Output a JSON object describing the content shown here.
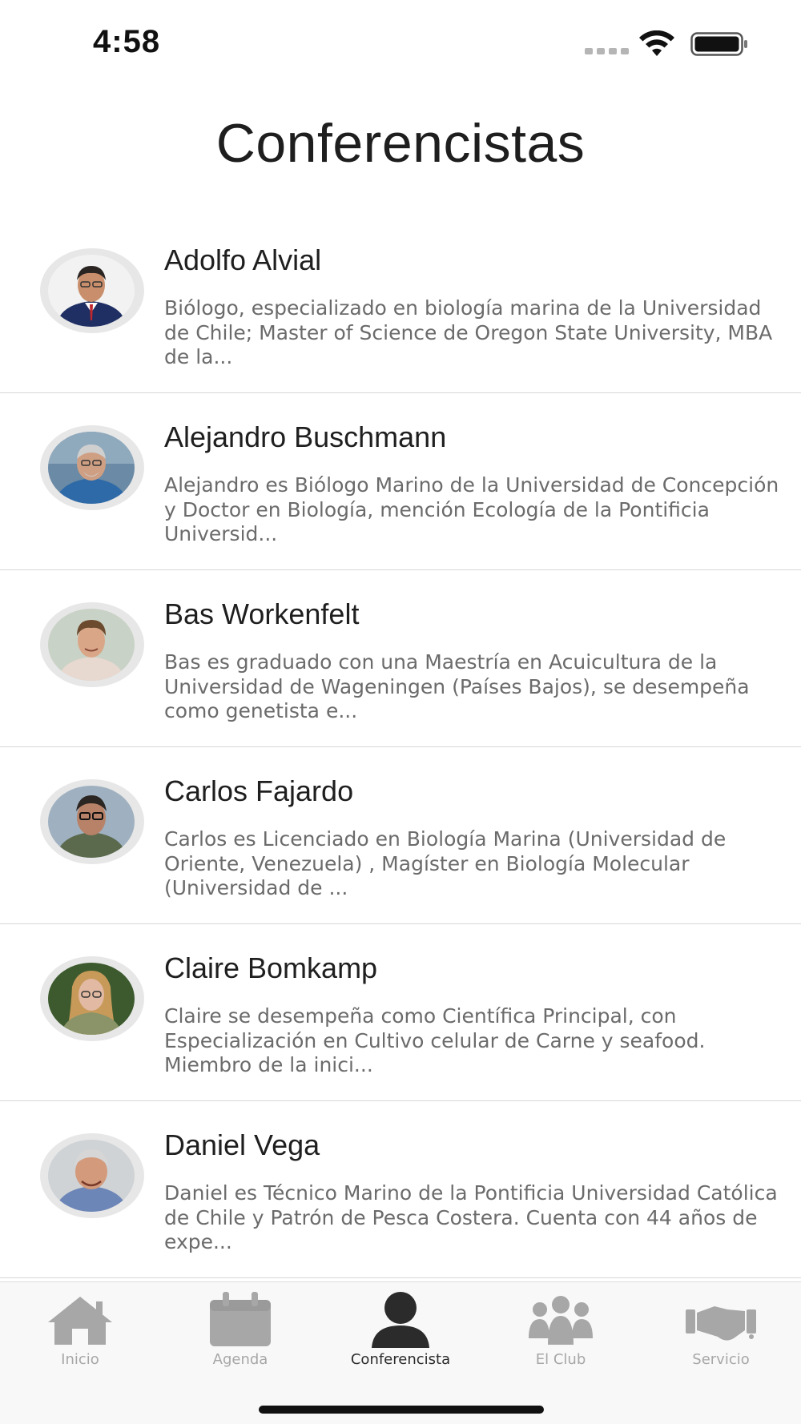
{
  "status_bar": {
    "time": "4:58",
    "icons": [
      "signal-dots-icon",
      "wifi-icon",
      "battery-icon"
    ]
  },
  "page": {
    "title": "Conferencistas"
  },
  "speakers": [
    {
      "name": "Adolfo Alvial",
      "bio": "Biólogo, especializado en biología marina de la Universidad de Chile; Master of Science de Oregon State University, MBA de la...",
      "avatar_colors": {
        "bg": "#f2f2f2",
        "skin": "#c98f6c",
        "hair": "#2a2522",
        "shirt": "#1f2f63"
      }
    },
    {
      "name": "Alejandro Buschmann",
      "bio": "Alejandro es Biólogo Marino de la Universidad de Concepción y Doctor en Biología, mención Ecología de la Pontificia Universid...",
      "avatar_colors": {
        "bg": "#6a8aa5",
        "skin": "#cf9f83",
        "hair": "#cfcfcf",
        "shirt": "#2f6aa8"
      }
    },
    {
      "name": "Bas Workenfelt",
      "bio": "Bas es graduado con una Maestría en Acuicultura de la Universidad de Wageningen (Países Bajos), se desempeña como genetista e...",
      "avatar_colors": {
        "bg": "#c9d2c6",
        "skin": "#d9a788",
        "hair": "#6b4a2e",
        "shirt": "#e7d8d0"
      }
    },
    {
      "name": "Carlos Fajardo",
      "bio": "Carlos es Licenciado en Biología Marina (Universidad de Oriente, Venezuela) , Magíster en Biología Molecular (Universidad de ...",
      "avatar_colors": {
        "bg": "#9fb1c0",
        "skin": "#b88268",
        "hair": "#2c2622",
        "shirt": "#5b6a4d"
      }
    },
    {
      "name": "Claire Bomkamp",
      "bio": "Claire se desempeña como Científica Principal, con Especialización en Cultivo celular de Carne y seafood. Miembro de la inici...",
      "avatar_colors": {
        "bg": "#3c5a2e",
        "skin": "#e2b9a2",
        "hair": "#c89a5a",
        "shirt": "#8a9468"
      }
    },
    {
      "name": "Daniel Vega",
      "bio": "Daniel es Técnico Marino de la Pontificia Universidad Católica de Chile y Patrón de Pesca Costera. Cuenta con 44 años de expe...",
      "avatar_colors": {
        "bg": "#cfd3d6",
        "skin": "#d39a7c",
        "hair": "#d6d6d6",
        "shirt": "#6d86b8"
      }
    }
  ],
  "tab_bar": {
    "tabs": [
      {
        "label": "Inicio",
        "icon": "home-icon",
        "active": false
      },
      {
        "label": "Agenda",
        "icon": "calendar-icon",
        "active": false
      },
      {
        "label": "Conferencista",
        "icon": "person-icon",
        "active": true
      },
      {
        "label": "El Club",
        "icon": "group-icon",
        "active": false
      },
      {
        "label": "Servicio",
        "icon": "handshake-icon",
        "active": false
      }
    ],
    "active_color": "#2b2b2b",
    "inactive_color": "#a7a7a7"
  }
}
